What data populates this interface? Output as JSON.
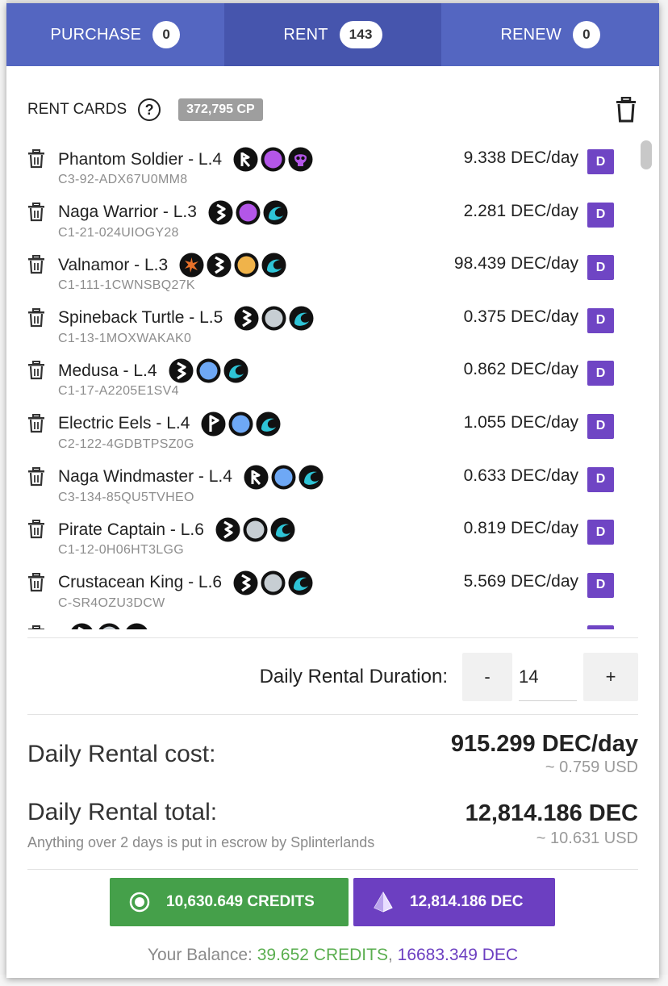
{
  "tabs": [
    {
      "label": "PURCHASE",
      "count": "0"
    },
    {
      "label": "RENT",
      "count": "143"
    },
    {
      "label": "RENEW",
      "count": "0"
    }
  ],
  "header": {
    "title": "RENT CARDS",
    "help_icon": "?",
    "cp": "372,795 CP"
  },
  "dec_badge": "D",
  "cards": [
    {
      "name": "Phantom Soldier - L.4",
      "id": "C3-92-ADX67U0MM8",
      "price": "9.338 DEC/day",
      "icons": [
        "ability-r",
        "purple",
        "death-skull"
      ]
    },
    {
      "name": "Naga Warrior - L.3",
      "id": "C1-21-024UIOGY28",
      "price": "2.281 DEC/day",
      "icons": [
        "ability-b",
        "purple",
        "water"
      ]
    },
    {
      "name": "Valnamor - L.3",
      "id": "C1-111-1CWNSBQ27K",
      "price": "98.439 DEC/day",
      "icons": [
        "spark",
        "ability-b",
        "gold",
        "water"
      ]
    },
    {
      "name": "Spineback Turtle - L.5",
      "id": "C1-13-1MOXWAKAK0",
      "price": "0.375 DEC/day",
      "icons": [
        "ability-b",
        "gray",
        "water"
      ]
    },
    {
      "name": "Medusa - L.4",
      "id": "C1-17-A2205E1SV4",
      "price": "0.862 DEC/day",
      "icons": [
        "ability-b",
        "blue",
        "water"
      ]
    },
    {
      "name": "Electric Eels - L.4",
      "id": "C2-122-4GDBTPSZ0G",
      "price": "1.055 DEC/day",
      "icons": [
        "ability-p",
        "blue",
        "water"
      ]
    },
    {
      "name": "Naga Windmaster - L.4",
      "id": "C3-134-85QU5TVHEO",
      "price": "0.633 DEC/day",
      "icons": [
        "ability-r",
        "blue",
        "water"
      ]
    },
    {
      "name": "Pirate Captain - L.6",
      "id": "C1-12-0H06HT3LGG",
      "price": "0.819 DEC/day",
      "icons": [
        "ability-b",
        "gray",
        "water"
      ]
    },
    {
      "name": "Crustacean King - L.6",
      "id": "C-SR4OZU3DCW",
      "price": "5.569 DEC/day",
      "icons": [
        "ability-b",
        "gray",
        "water"
      ]
    },
    {
      "name": "",
      "id": "",
      "price": "",
      "icons": [
        "ability-b",
        "gray",
        "water"
      ]
    }
  ],
  "duration": {
    "label": "Daily Rental Duration:",
    "minus": "-",
    "value": "14",
    "plus": "+"
  },
  "cost": {
    "label": "Daily Rental cost:",
    "value": "915.299 DEC/day",
    "usd": "~ 0.759 USD"
  },
  "total": {
    "label": "Daily Rental total:",
    "note": "Anything over 2 days is put in escrow by Splinterlands",
    "value": "12,814.186 DEC",
    "usd": "~ 10.631 USD"
  },
  "pay": {
    "credits_label": "10,630.649 CREDITS",
    "dec_label": "12,814.186 DEC"
  },
  "balance": {
    "prefix": "Your Balance: ",
    "credits": "39.652 CREDITS",
    "sep": ", ",
    "dec": "16683.349 DEC"
  },
  "colors": {
    "tab_bar": "#5466c1",
    "dec_purple": "#6f45c4",
    "credits_green": "#45a04a",
    "water": "#2ec4d6",
    "life_purple": "#b356e8",
    "mana_blue": "#6ea8f5",
    "gold": "#f0b34a"
  }
}
